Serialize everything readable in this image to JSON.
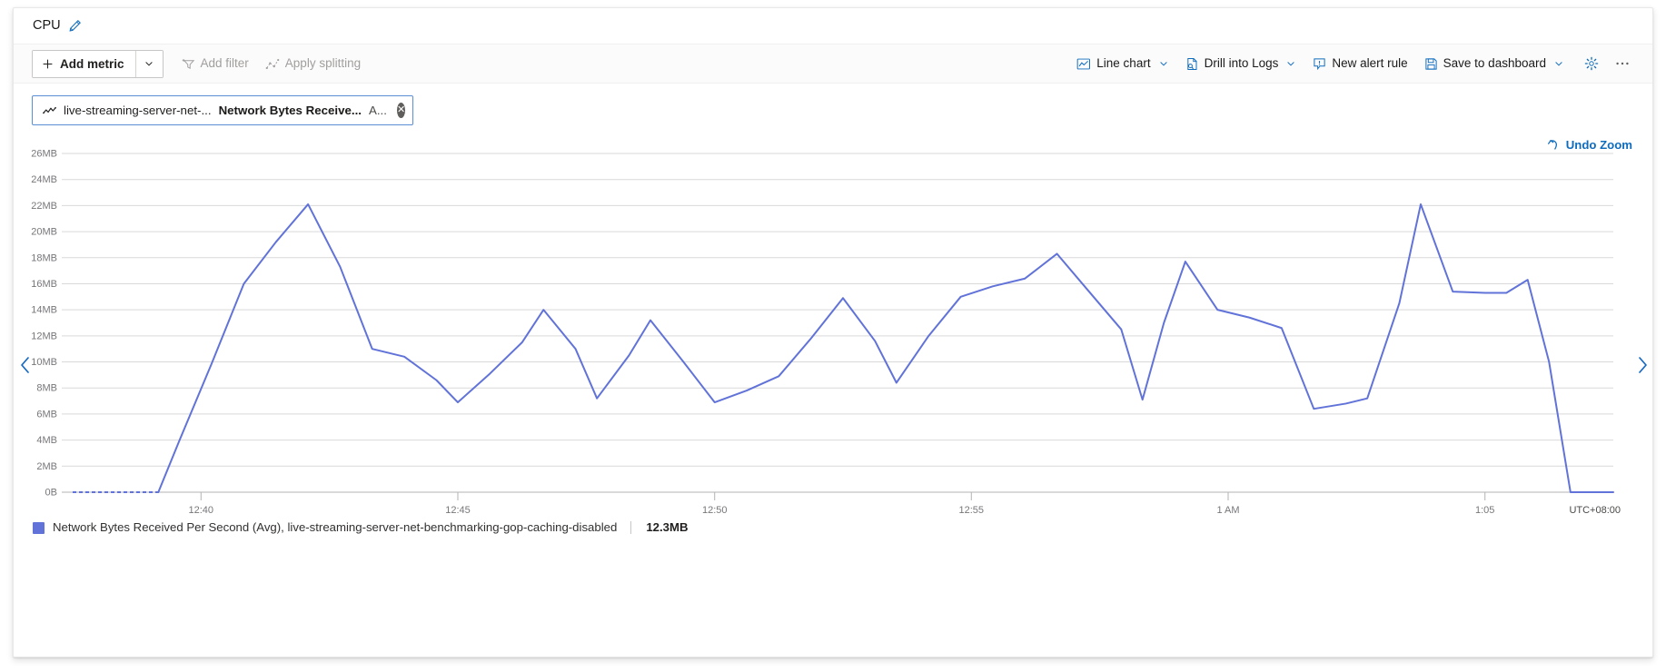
{
  "panel": {
    "title": "CPU",
    "edit_icon": "pencil-icon"
  },
  "toolbar": {
    "add_metric_label": "Add metric",
    "add_metric_caret": "chevron-down-icon",
    "add_filter_label": "Add filter",
    "apply_splitting_label": "Apply splitting",
    "chart_type_label": "Line chart",
    "drill_into_logs_label": "Drill into Logs",
    "new_alert_rule_label": "New alert rule",
    "save_to_dashboard_label": "Save to dashboard",
    "settings_icon": "gear-icon",
    "more_icon": "ellipsis-icon"
  },
  "metric_chip": {
    "resource": "live-streaming-server-net-...",
    "metric": "Network Bytes Receive...",
    "aggregation": "A...",
    "close_icon": "close-circle-icon"
  },
  "undo_zoom": {
    "label": "Undo Zoom",
    "icon": "undo-arrow-icon"
  },
  "navigation": {
    "previous_icon": "chevron-left-icon",
    "next_icon": "chevron-right-icon"
  },
  "legend": {
    "series_label": "Network Bytes Received Per Second (Avg), live-streaming-server-net-benchmarking-gop-caching-disabled",
    "value": "12.3MB",
    "swatch_color": "#6173d8"
  },
  "colors": {
    "series": "#6173d8",
    "accent": "#0f6cbd",
    "chip_border": "#5a8fd6",
    "gridline": "#d9d9d9",
    "axis_text": "#77767a"
  },
  "chart_data": {
    "type": "line",
    "title": "",
    "xlabel": "",
    "ylabel": "",
    "ylim": [
      0,
      26
    ],
    "yunit": "MB",
    "ytick_labels": [
      "0B",
      "2MB",
      "4MB",
      "6MB",
      "8MB",
      "10MB",
      "12MB",
      "14MB",
      "16MB",
      "18MB",
      "20MB",
      "22MB",
      "24MB",
      "26MB"
    ],
    "ytick_values": [
      0,
      2,
      4,
      6,
      8,
      10,
      12,
      14,
      16,
      18,
      20,
      22,
      24,
      26
    ],
    "xtick_labels": [
      "12:40",
      "12:45",
      "12:50",
      "12:55",
      "1 AM",
      "1:05"
    ],
    "xtick_positions": [
      0.0833,
      0.25,
      0.4167,
      0.5833,
      0.75,
      0.9167
    ],
    "timezone_label": "UTC+08:00",
    "grid": true,
    "legend_position": "bottom-left",
    "series": [
      {
        "name": "Network Bytes Received Per Second (Avg), live-streaming-server-net-benchmarking-gop-caching-disabled",
        "color": "#6173d8",
        "current_value": 12.3,
        "x": [
          0.0,
          0.0139,
          0.0278,
          0.0417,
          0.0556,
          0.0694,
          0.0833,
          0.0972,
          0.1111,
          0.125,
          0.1389,
          0.1528,
          0.1667,
          0.1806,
          0.1944,
          0.2083,
          0.2222,
          0.2361,
          0.25,
          0.2639,
          0.2778,
          0.2917,
          0.3056,
          0.3194,
          0.3333,
          0.3472,
          0.3611,
          0.375,
          0.3889,
          0.4028,
          0.4167,
          0.4306,
          0.4444,
          0.4583,
          0.4722,
          0.4861,
          0.5,
          0.5139,
          0.5278,
          0.5417,
          0.5556,
          0.5694,
          0.5833,
          0.5972,
          0.6111,
          0.625,
          0.6389,
          0.6528,
          0.6667,
          0.6806,
          0.6944,
          0.7083,
          0.7222,
          0.7361,
          0.75,
          0.7639,
          0.7778,
          0.7917,
          0.8056,
          0.8194,
          0.8333,
          0.8472,
          0.8611,
          0.875,
          0.8889,
          0.9028,
          0.9167,
          0.9306,
          0.9444,
          0.9583,
          0.9722,
          0.9861,
          1.0
        ],
        "values": [
          0.0,
          0.0,
          0.0,
          0.0,
          0.0,
          0.0,
          0.0,
          4.0,
          9.9,
          16.0,
          19.0,
          22.1,
          17.2,
          11.0,
          10.4,
          9.0,
          6.9,
          10.2,
          11.9,
          14.0,
          11.0,
          8.1,
          7.2,
          10.5,
          13.2,
          10.1,
          8.0,
          6.9,
          7.8,
          8.9,
          11.8,
          14.9,
          11.6,
          8.4,
          12.0,
          15.0,
          15.8,
          16.4,
          18.3,
          15.4,
          12.5,
          10.0,
          7.1,
          13.0,
          17.7,
          14.0,
          13.4,
          12.6,
          9.5,
          6.4,
          6.8,
          7.2,
          14.5,
          22.1,
          18.5,
          15.4,
          15.3,
          15.3,
          15.5,
          16.3,
          10.0,
          3.0,
          0.0,
          0.0
        ],
        "note": "x values are normalized 0..1 across the plotted time range; values are in MB"
      }
    ],
    "points": [
      {
        "x": 0.0,
        "y": 0.0
      },
      {
        "x": 0.0139,
        "y": 0.0
      },
      {
        "x": 0.0278,
        "y": 0.0
      },
      {
        "x": 0.0417,
        "y": 0.0
      },
      {
        "x": 0.0556,
        "y": 0.0
      },
      {
        "x": 0.0694,
        "y": 4.0
      },
      {
        "x": 0.0903,
        "y": 9.9
      },
      {
        "x": 0.1111,
        "y": 16.0
      },
      {
        "x": 0.1319,
        "y": 19.2
      },
      {
        "x": 0.1528,
        "y": 22.1
      },
      {
        "x": 0.1736,
        "y": 17.3
      },
      {
        "x": 0.1944,
        "y": 11.0
      },
      {
        "x": 0.2153,
        "y": 10.4
      },
      {
        "x": 0.2361,
        "y": 8.6
      },
      {
        "x": 0.25,
        "y": 6.9
      },
      {
        "x": 0.2708,
        "y": 9.1
      },
      {
        "x": 0.2917,
        "y": 11.5
      },
      {
        "x": 0.3056,
        "y": 14.0
      },
      {
        "x": 0.3264,
        "y": 11.0
      },
      {
        "x": 0.3403,
        "y": 7.2
      },
      {
        "x": 0.3611,
        "y": 10.5
      },
      {
        "x": 0.375,
        "y": 13.2
      },
      {
        "x": 0.3958,
        "y": 10.1
      },
      {
        "x": 0.4167,
        "y": 6.9
      },
      {
        "x": 0.4375,
        "y": 7.8
      },
      {
        "x": 0.4583,
        "y": 8.9
      },
      {
        "x": 0.4792,
        "y": 11.8
      },
      {
        "x": 0.5,
        "y": 14.9
      },
      {
        "x": 0.5208,
        "y": 11.6
      },
      {
        "x": 0.5347,
        "y": 8.4
      },
      {
        "x": 0.5556,
        "y": 12.0
      },
      {
        "x": 0.5764,
        "y": 15.0
      },
      {
        "x": 0.5972,
        "y": 15.8
      },
      {
        "x": 0.6181,
        "y": 16.4
      },
      {
        "x": 0.6389,
        "y": 18.3
      },
      {
        "x": 0.6597,
        "y": 15.4
      },
      {
        "x": 0.6806,
        "y": 12.5
      },
      {
        "x": 0.6944,
        "y": 7.1
      },
      {
        "x": 0.7083,
        "y": 13.0
      },
      {
        "x": 0.7222,
        "y": 17.7
      },
      {
        "x": 0.7431,
        "y": 14.0
      },
      {
        "x": 0.7639,
        "y": 13.4
      },
      {
        "x": 0.7847,
        "y": 12.6
      },
      {
        "x": 0.8056,
        "y": 6.4
      },
      {
        "x": 0.8264,
        "y": 6.8
      },
      {
        "x": 0.8403,
        "y": 7.2
      },
      {
        "x": 0.8611,
        "y": 14.5
      },
      {
        "x": 0.875,
        "y": 22.1
      },
      {
        "x": 0.8958,
        "y": 15.4
      },
      {
        "x": 0.9167,
        "y": 15.3
      },
      {
        "x": 0.9306,
        "y": 15.3
      },
      {
        "x": 0.9444,
        "y": 16.3
      },
      {
        "x": 0.9583,
        "y": 10.0
      },
      {
        "x": 0.9722,
        "y": 0.0
      },
      {
        "x": 1.0,
        "y": 0.0
      }
    ]
  }
}
